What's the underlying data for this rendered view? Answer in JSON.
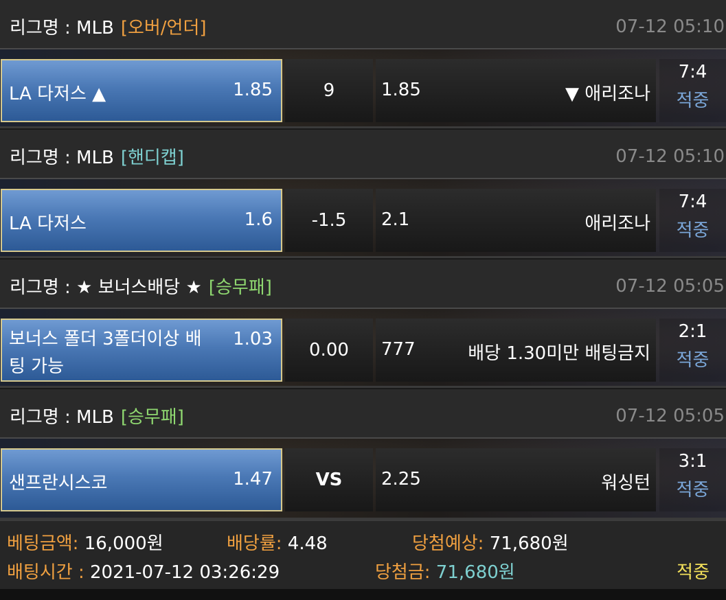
{
  "bets": [
    {
      "league_prefix": "리그명 : MLB",
      "tag": "[오버/언더]",
      "tag_color": "#f0a040",
      "time": "07-12 05:10",
      "home_team": "LA 다저스 ▲",
      "home_odds": "1.85",
      "middle": "9",
      "away_odds": "1.85",
      "away_team": "▼ 애리조나",
      "score": "7:4",
      "status": "적중"
    },
    {
      "league_prefix": "리그명 : MLB",
      "tag": "[핸디캡]",
      "tag_color": "#7ed0d0",
      "time": "07-12 05:10",
      "home_team": "LA 다저스",
      "home_odds": "1.6",
      "middle": "-1.5",
      "away_odds": "2.1",
      "away_team": "애리조나",
      "score": "7:4",
      "status": "적중"
    },
    {
      "league_prefix": "리그명 : ★ 보너스배당 ★",
      "tag": "[승무패]",
      "tag_color": "#8fd870",
      "time": "07-12 05:05",
      "home_team": "보너스 폴더 3폴더이상 배팅 가능",
      "home_odds": "1.03",
      "middle": "0.00",
      "away_odds": "777",
      "away_team": "배당 1.30미만 배팅금지",
      "score": "2:1",
      "status": "적중"
    },
    {
      "league_prefix": "리그명 : MLB",
      "tag": "[승무패]",
      "tag_color": "#8fd870",
      "time": "07-12 05:05",
      "home_team": "샌프란시스코",
      "home_odds": "1.47",
      "middle": "VS",
      "away_odds": "2.25",
      "away_team": "워싱턴",
      "score": "3:1",
      "status": "적중"
    }
  ],
  "summary": {
    "bet_amount_label": "베팅금액:",
    "bet_amount": "16,000원",
    "odds_label": "배당률:",
    "odds": "4.48",
    "expected_label": "당첨예상:",
    "expected": "71,680원",
    "bet_time_label": "배팅시간 :",
    "bet_time": "2021-07-12 03:26:29",
    "win_label": "당첨금:",
    "win_amount": "71,680원",
    "final_status": "적중"
  },
  "colors": {
    "home_button": "#4a78b5",
    "home_border": "#d7c98c",
    "status_hit": "#7aa6d8",
    "label_orange": "#f0a040",
    "final_yellow": "#f3e05a"
  }
}
